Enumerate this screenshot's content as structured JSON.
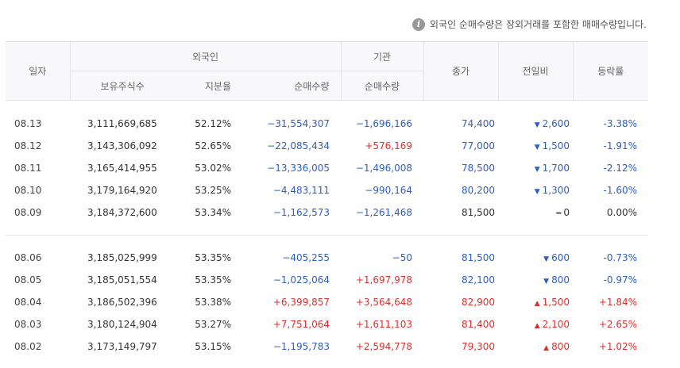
{
  "notice": {
    "icon": "info-icon",
    "text": "외국인 순매수량은 장외거래를 포함한 매매수량입니다."
  },
  "headers": {
    "date": "일자",
    "foreign": "외국인",
    "institution": "기관",
    "close": "종가",
    "change": "전일비",
    "rate": "등락률",
    "shares": "보유주식수",
    "ratio": "지분율",
    "foreign_net": "순매수량",
    "inst_net": "순매수량"
  },
  "group1": [
    {
      "date": "08.13",
      "shares": "3,111,669,685",
      "ratio": "52.12%",
      "foreign_net": "−31,554,307",
      "foreign_dir": "neg",
      "inst_net": "−1,696,166",
      "inst_dir": "neg",
      "close": "74,400",
      "close_dir": "neg",
      "change": "2,600",
      "change_dir": "down",
      "rate": "-3.38%"
    },
    {
      "date": "08.12",
      "shares": "3,143,306,092",
      "ratio": "52.65%",
      "foreign_net": "−22,085,434",
      "foreign_dir": "neg",
      "inst_net": "+576,169",
      "inst_dir": "pos",
      "close": "77,000",
      "close_dir": "neg",
      "change": "1,500",
      "change_dir": "down",
      "rate": "-1.91%"
    },
    {
      "date": "08.11",
      "shares": "3,165,414,955",
      "ratio": "53.02%",
      "foreign_net": "−13,336,005",
      "foreign_dir": "neg",
      "inst_net": "−1,496,008",
      "inst_dir": "neg",
      "close": "78,500",
      "close_dir": "neg",
      "change": "1,700",
      "change_dir": "down",
      "rate": "-2.12%"
    },
    {
      "date": "08.10",
      "shares": "3,179,164,920",
      "ratio": "53.25%",
      "foreign_net": "−4,483,111",
      "foreign_dir": "neg",
      "inst_net": "−990,164",
      "inst_dir": "neg",
      "close": "80,200",
      "close_dir": "neg",
      "change": "1,300",
      "change_dir": "down",
      "rate": "-1.60%"
    },
    {
      "date": "08.09",
      "shares": "3,184,372,600",
      "ratio": "53.34%",
      "foreign_net": "−1,162,573",
      "foreign_dir": "neg",
      "inst_net": "−1,261,468",
      "inst_dir": "neg",
      "close": "81,500",
      "close_dir": "flat",
      "change": "0",
      "change_dir": "flat",
      "rate": "0.00%"
    }
  ],
  "group2": [
    {
      "date": "08.06",
      "shares": "3,185,025,999",
      "ratio": "53.35%",
      "foreign_net": "−405,255",
      "foreign_dir": "neg",
      "inst_net": "−50",
      "inst_dir": "neg",
      "close": "81,500",
      "close_dir": "neg",
      "change": "600",
      "change_dir": "down",
      "rate": "-0.73%"
    },
    {
      "date": "08.05",
      "shares": "3,185,051,554",
      "ratio": "53.35%",
      "foreign_net": "−1,025,064",
      "foreign_dir": "neg",
      "inst_net": "+1,697,978",
      "inst_dir": "pos",
      "close": "82,100",
      "close_dir": "neg",
      "change": "800",
      "change_dir": "down",
      "rate": "-0.97%"
    },
    {
      "date": "08.04",
      "shares": "3,186,502,396",
      "ratio": "53.38%",
      "foreign_net": "+6,399,857",
      "foreign_dir": "pos",
      "inst_net": "+3,564,648",
      "inst_dir": "pos",
      "close": "82,900",
      "close_dir": "pos",
      "change": "1,500",
      "change_dir": "up",
      "rate": "+1.84%"
    },
    {
      "date": "08.03",
      "shares": "3,180,124,904",
      "ratio": "53.27%",
      "foreign_net": "+7,751,064",
      "foreign_dir": "pos",
      "inst_net": "+1,611,103",
      "inst_dir": "pos",
      "close": "81,400",
      "close_dir": "pos",
      "change": "2,100",
      "change_dir": "up",
      "rate": "+2.65%"
    },
    {
      "date": "08.02",
      "shares": "3,173,149,797",
      "ratio": "53.15%",
      "foreign_net": "−1,195,783",
      "foreign_dir": "neg",
      "inst_net": "+2,594,778",
      "inst_dir": "pos",
      "close": "79,300",
      "close_dir": "pos",
      "change": "800",
      "change_dir": "up",
      "rate": "+1.02%"
    }
  ],
  "colors": {
    "up": "#e22d2d",
    "down": "#2c5ec4",
    "flat": "#333333"
  }
}
